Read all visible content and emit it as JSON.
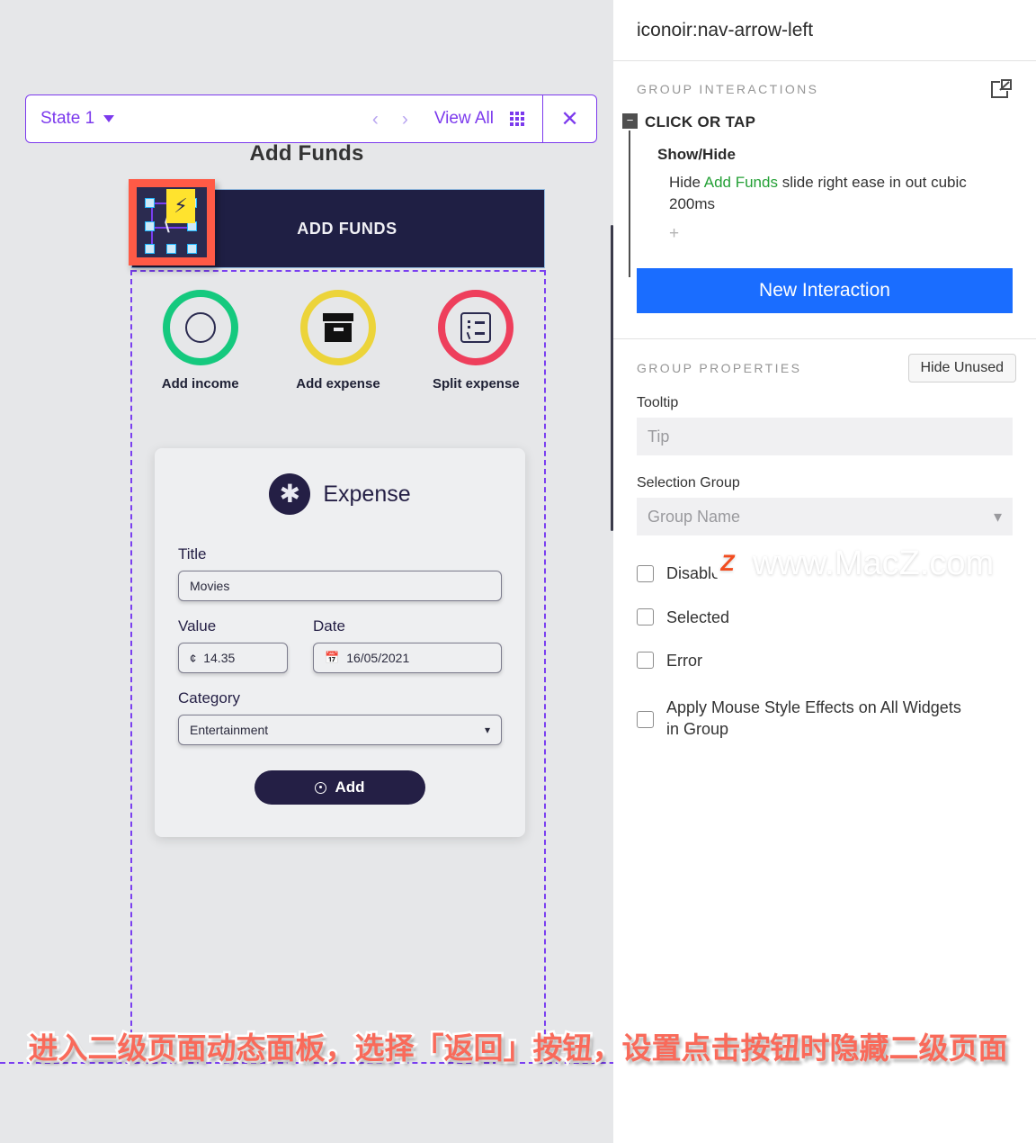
{
  "canvas": {
    "toolbar": {
      "state_label": "State 1",
      "view_all_label": "View All",
      "prev_icon": "chevron-left-icon",
      "next_icon": "chevron-right-icon",
      "grid_icon": "grid-icon",
      "close_icon": "close-icon"
    },
    "screen_title": "Add Funds",
    "app": {
      "header_bar_label": "ADD FUNDS",
      "selected_widget": {
        "icon": "nav-arrow-left-icon",
        "badge_icon": "lightning-bolt-icon"
      },
      "actions": [
        {
          "label": "Add income",
          "icon": "circle-outline-icon",
          "ring_color": "#15c97e"
        },
        {
          "label": "Add expense",
          "icon": "box-icon",
          "ring_color": "#ecd43a"
        },
        {
          "label": "Split expense",
          "icon": "receipt-icon",
          "ring_color": "#ee3f5c"
        }
      ],
      "form": {
        "card_title": "Expense",
        "card_icon": "asterisk-icon",
        "title_label": "Title",
        "title_value": "Movies",
        "value_label": "Value",
        "value_icon": "currency-icon",
        "value_value": "14.35",
        "date_label": "Date",
        "date_icon": "calendar-icon",
        "date_value": "16/05/2021",
        "category_label": "Category",
        "category_value": "Entertainment",
        "category_chevron": "chevron-down-icon",
        "add_button_label": "Add",
        "add_button_icon": "plus-circle-icon"
      }
    }
  },
  "panel": {
    "title": "iconoir:nav-arrow-left",
    "interactions": {
      "section_title": "GROUP INTERACTIONS",
      "external_icon": "open-external-icon",
      "toggle_glyph": "−",
      "trigger": "CLICK OR TAP",
      "action_kind": "Show/Hide",
      "action_prefix": "Hide ",
      "action_target": "Add Funds",
      "action_suffix": " slide right ease in out cubic 200ms",
      "add_action_glyph": "+",
      "new_interaction_label": "New Interaction"
    },
    "properties": {
      "section_title": "GROUP PROPERTIES",
      "hide_unused_label": "Hide Unused",
      "tooltip_label": "Tooltip",
      "tooltip_placeholder": "Tip",
      "selection_group_label": "Selection Group",
      "selection_group_placeholder": "Group Name",
      "selection_group_chevron": "chevron-down-icon",
      "checkboxes": [
        {
          "label": "Disabled",
          "checked": false
        },
        {
          "label": "Selected",
          "checked": false
        },
        {
          "label": "Error",
          "checked": false
        },
        {
          "label": "Apply Mouse Style Effects on All Widgets in Group",
          "checked": false
        }
      ]
    }
  },
  "watermark": {
    "badge": "Z",
    "text": "www.MacZ.com"
  },
  "caption": "进入二级页面动态面板，选择「返回」按钮，设置点击按钮时隐藏二级页面",
  "colors": {
    "accent_purple": "#7c3aed",
    "primary_blue": "#1a6dff",
    "target_green": "#24a036",
    "selection_red": "#ff5a46",
    "dark_navy": "#1f1f44"
  }
}
